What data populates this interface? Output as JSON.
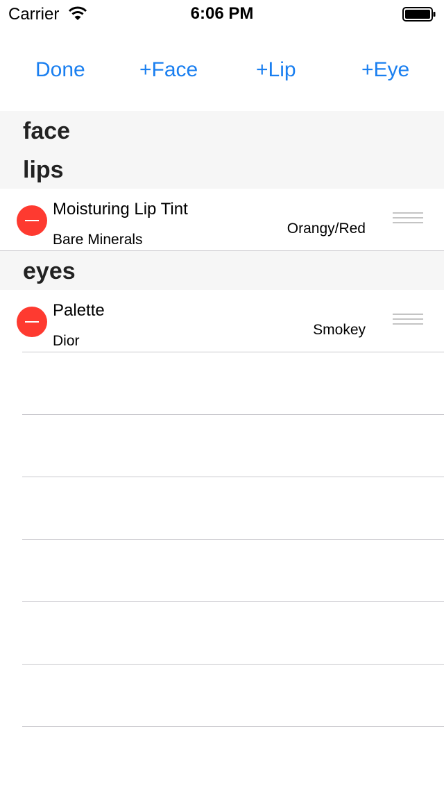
{
  "status_bar": {
    "carrier": "Carrier",
    "time": "6:06 PM"
  },
  "toolbar": {
    "done_label": "Done",
    "add_face_label": "+Face",
    "add_lip_label": "+Lip",
    "add_eye_label": "+Eye"
  },
  "sections": [
    {
      "title": "face",
      "items": []
    },
    {
      "title": "lips",
      "items": [
        {
          "name": "Moisturing Lip Tint",
          "brand": "Bare Minerals",
          "shade": "Orangy/Red"
        }
      ]
    },
    {
      "title": "eyes",
      "items": [
        {
          "name": "Palette",
          "brand": "Dior",
          "shade": "Smokey"
        }
      ]
    }
  ],
  "colors": {
    "tint": "#1a7ff0",
    "delete_red": "#fe3a30",
    "section_bg": "#f6f6f6",
    "separator": "#c8c7cc"
  }
}
